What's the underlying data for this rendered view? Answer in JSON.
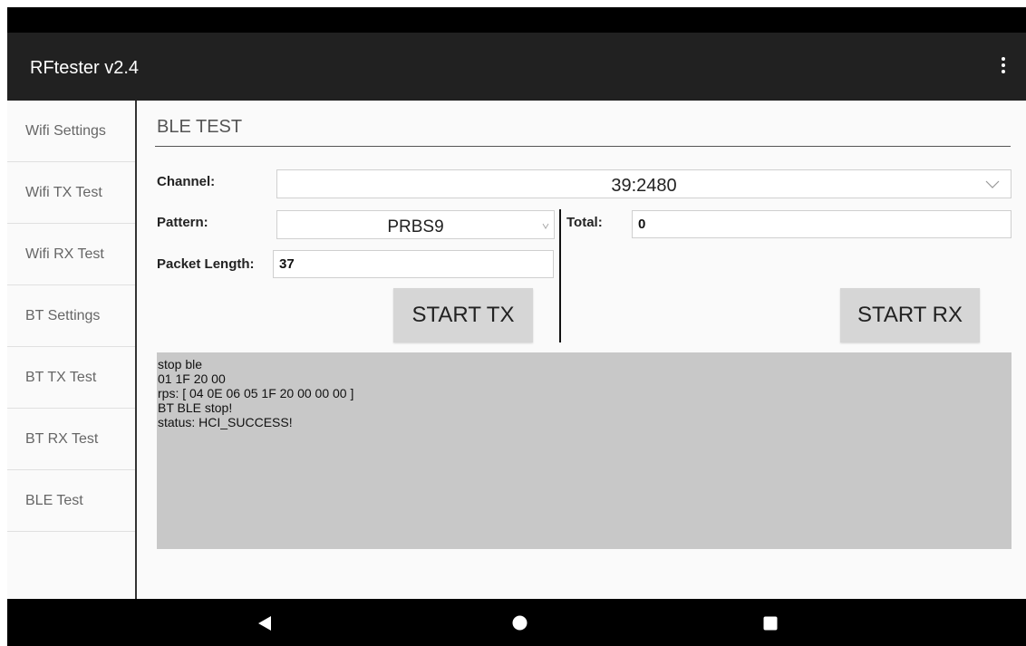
{
  "app": {
    "title": "RFtester v2.4"
  },
  "sidebar": {
    "items": [
      {
        "label": "Wifi Settings"
      },
      {
        "label": "Wifi TX Test"
      },
      {
        "label": "Wifi RX Test"
      },
      {
        "label": "BT Settings"
      },
      {
        "label": "BT TX Test"
      },
      {
        "label": "BT RX Test"
      },
      {
        "label": "BLE Test"
      }
    ]
  },
  "main": {
    "title": "BLE TEST",
    "channel_label": "Channel:",
    "channel_value": "39:2480",
    "pattern_label": "Pattern:",
    "pattern_value": "PRBS9",
    "packet_length_label": "Packet Length:",
    "packet_length_value": "37",
    "total_label": "Total:",
    "total_value": "0",
    "start_tx_label": "START TX",
    "start_rx_label": "START RX"
  },
  "log": {
    "lines": [
      "stop ble",
      "01 1F 20 00",
      "rps: [ 04 0E 06 05 1F 20 00 00 00 ]",
      "BT BLE stop!",
      "status: HCI_SUCCESS!"
    ]
  },
  "icons": {
    "overflow": "more-vert-icon",
    "back": "back-triangle-icon",
    "home": "home-circle-icon",
    "recents": "recents-square-icon",
    "dropdown": "chevron-down-icon"
  }
}
